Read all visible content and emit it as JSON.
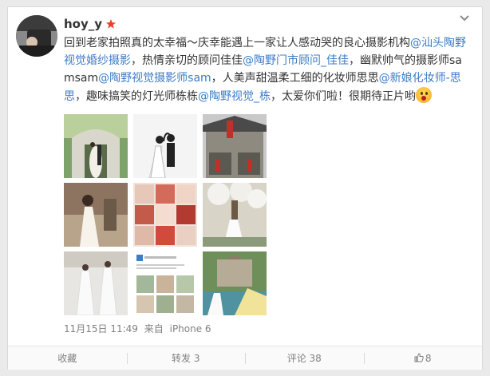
{
  "post": {
    "username": "hoy_y",
    "text_parts": [
      {
        "t": "text",
        "v": "回到老家拍照真的太幸福～庆幸能遇上一家让人感动哭的良心摄影机构"
      },
      {
        "t": "link",
        "v": "@汕头陶野视觉婚纱摄影"
      },
      {
        "t": "text",
        "v": "，热情亲切的顾问佳佳"
      },
      {
        "t": "link",
        "v": "@陶野门市顾问_佳佳"
      },
      {
        "t": "text",
        "v": "，幽默帅气的摄影师samsam"
      },
      {
        "t": "link",
        "v": "@陶野视觉摄影师sam"
      },
      {
        "t": "text",
        "v": "，人美声甜温柔工细的化妆师思思"
      },
      {
        "t": "link",
        "v": "@新娘化妆师-思思"
      },
      {
        "t": "text",
        "v": "，趣味搞笑的灯光师栋栋"
      },
      {
        "t": "link",
        "v": "@陶野视觉_栋"
      },
      {
        "t": "text",
        "v": "，太爱你们啦！很期待正片哟"
      }
    ],
    "date": "11月15日 11:49",
    "source_prefix": "来自",
    "source": "iPhone 6",
    "photos": [
      "photo-1",
      "photo-2",
      "photo-3",
      "photo-4",
      "photo-5",
      "photo-6",
      "photo-7",
      "photo-8",
      "photo-9"
    ]
  },
  "actions": {
    "favorite": "收藏",
    "repost": "转发 3",
    "comment": "评论 38",
    "like": "8"
  },
  "icons": [
    "avatar",
    "chevron-down-icon",
    "vip-badge-icon",
    "surprised-emoji-icon",
    "thumb-up-icon"
  ],
  "colors": {
    "link": "#3d7cc7",
    "meta": "#808080",
    "vip": "#e8402a"
  }
}
